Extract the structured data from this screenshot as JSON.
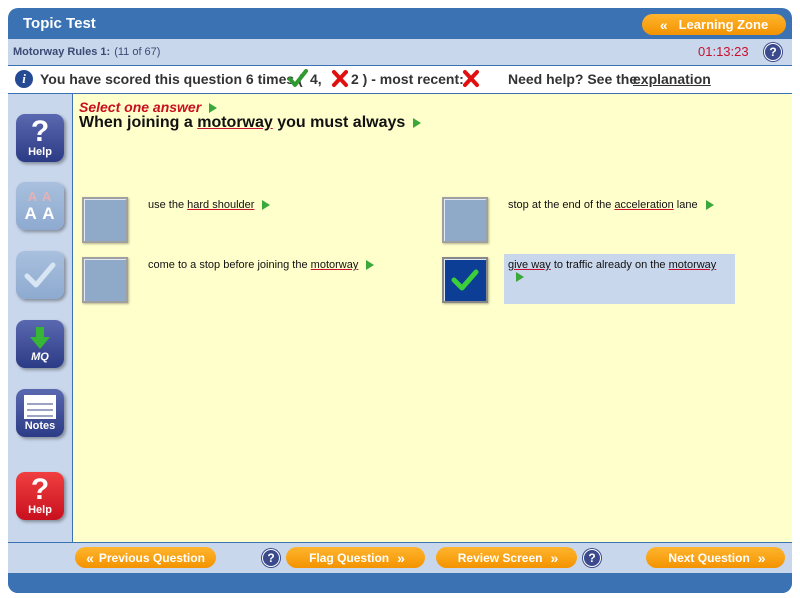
{
  "app": {
    "title": "Topic Test",
    "learning_zone_label": "Learning Zone"
  },
  "info": {
    "section": "Motorway Rules 1:",
    "count": "(11 of 67)",
    "timer": "01:13:23"
  },
  "score": {
    "text_pre": "You have scored this question 6 times (",
    "correct": "4,",
    "wrong": "2 ) - most recent:",
    "help_text": "Need help? See the",
    "explanation_link": "explanation"
  },
  "sidebar": {
    "help_label": "Help",
    "text_size_top": "A A",
    "text_size_bottom": "A A",
    "mq_label": "MQ",
    "notes_label": "Notes",
    "help2_label": "Help"
  },
  "question": {
    "prompt": "Select one answer",
    "stem_pre": "When joining a ",
    "stem_kw": "motorway",
    "stem_post": " you must always"
  },
  "answers": [
    {
      "pre": "use the ",
      "kw": "hard shoulder",
      "post": "",
      "selected": false
    },
    {
      "pre": "stop at the end of the ",
      "kw": "acceleration",
      "post": " lane",
      "selected": false
    },
    {
      "pre": "come to a stop before joining the ",
      "kw": "motorway",
      "post": "",
      "selected": false
    },
    {
      "pre": "",
      "kw": "give way",
      "mid": " to traffic already on the ",
      "kw2": "motorway",
      "selected": true
    }
  ],
  "nav": {
    "prev": "Previous Question",
    "flag": "Flag Question",
    "review": "Review Screen",
    "next": "Next Question"
  },
  "colors": {
    "frame": "#3a72b4",
    "bar": "#c9d7ec",
    "content": "#ffffcc",
    "accent_orange": "#f39300",
    "timer_red": "#c8102e",
    "tick_green": "#2f9a2f",
    "selected_box": "#0c3e95"
  }
}
